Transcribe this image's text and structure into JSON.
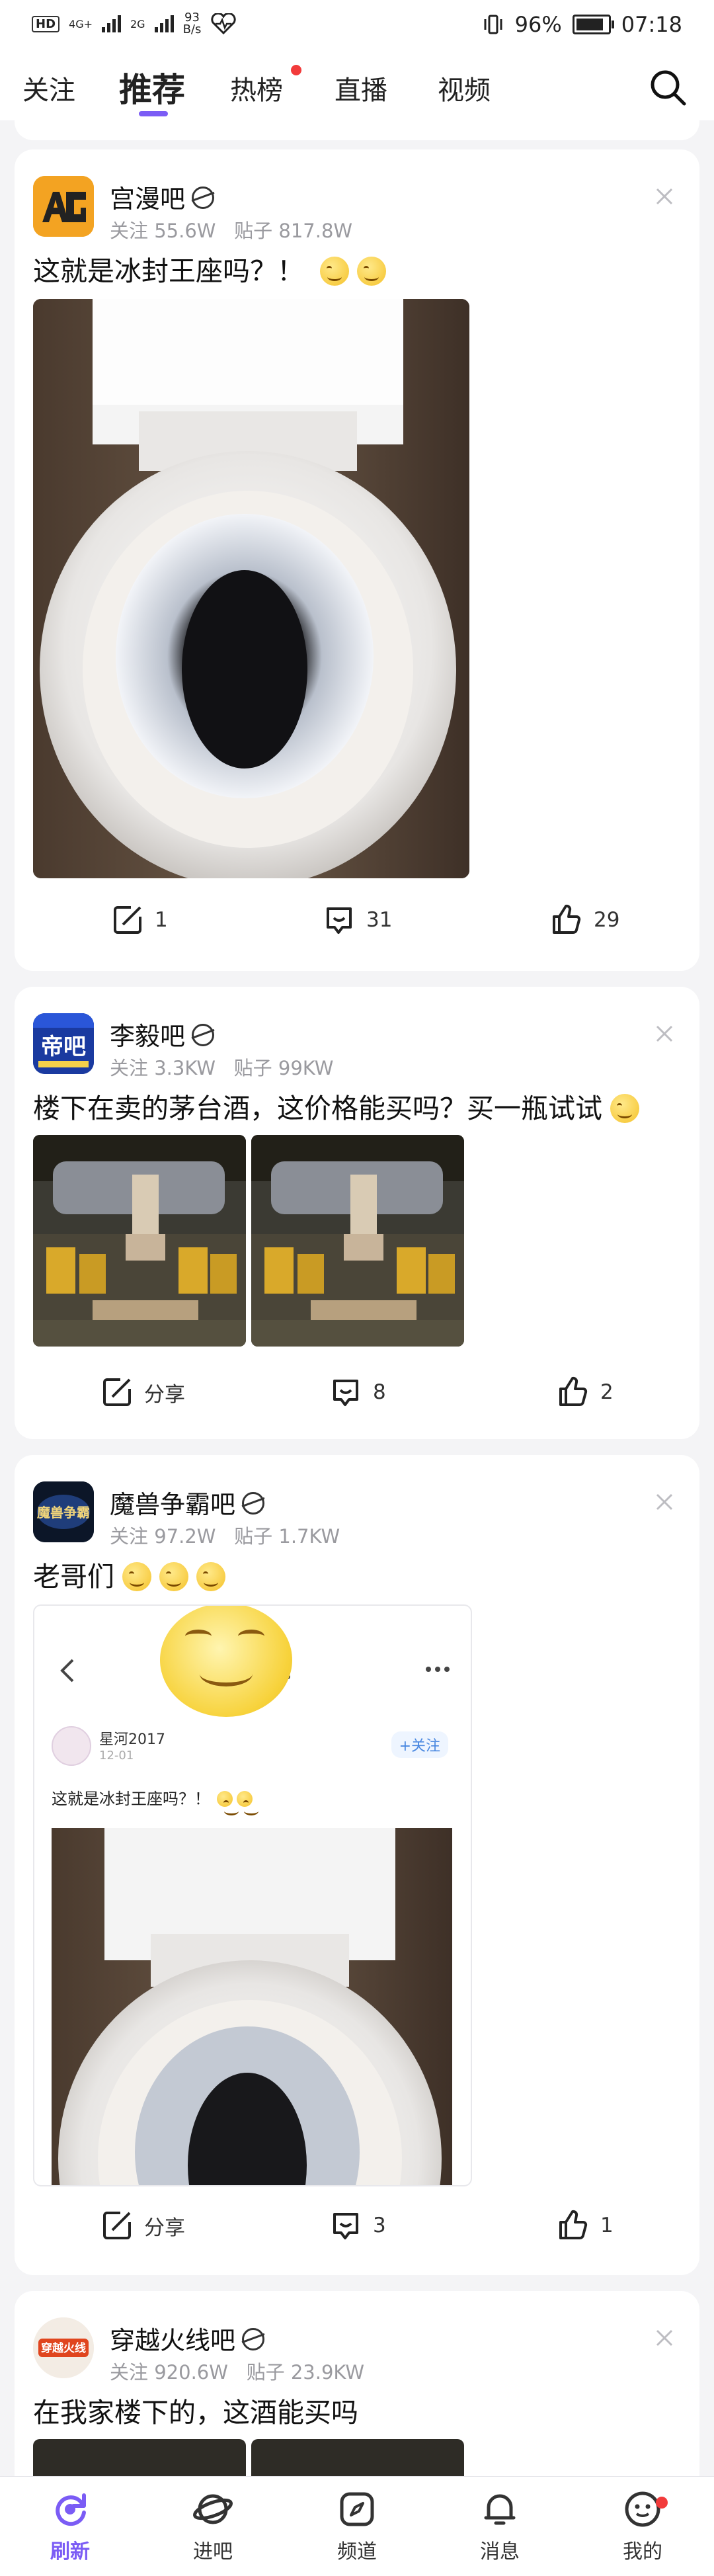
{
  "status_bar": {
    "hd": "HD",
    "net1": "4G+",
    "net2": "2G",
    "speed_value": "93",
    "speed_unit": "B/s",
    "battery": "96%",
    "time": "07:18"
  },
  "top_nav": {
    "tabs": [
      {
        "label": "关注"
      },
      {
        "label": "推荐"
      },
      {
        "label": "热榜"
      },
      {
        "label": "直播"
      },
      {
        "label": "视频"
      }
    ],
    "active_index": 1
  },
  "posts": [
    {
      "forum": "宫漫吧",
      "follow_label": "关注",
      "follow_count": "55.6W",
      "posts_label": "贴子",
      "posts_count": "817.8W",
      "title": "这就是冰封王座吗？！",
      "actions": {
        "share": "1",
        "comments": "31",
        "likes": "29"
      }
    },
    {
      "forum": "李毅吧",
      "follow_label": "关注",
      "follow_count": "3.3KW",
      "posts_label": "贴子",
      "posts_count": "99KW",
      "title": "楼下在卖的茅台酒，这价格能买吗？买一瓶试试",
      "actions": {
        "share": "分享",
        "comments": "8",
        "likes": "2"
      }
    },
    {
      "forum": "魔兽争霸吧",
      "follow_label": "关注",
      "follow_count": "97.2W",
      "posts_label": "贴子",
      "posts_count": "1.7KW",
      "title": "老哥们",
      "embedded": {
        "user": "星河2017",
        "date": "12-01",
        "follow_btn": "+关注",
        "post_title": "这就是冰封王座吗？！",
        "header_suffix": "吧"
      },
      "actions": {
        "share": "分享",
        "comments": "3",
        "likes": "1"
      }
    },
    {
      "forum": "穿越火线吧",
      "follow_label": "关注",
      "follow_count": "920.6W",
      "posts_label": "贴子",
      "posts_count": "23.9KW",
      "title": "在我家楼下的，这酒能买吗"
    }
  ],
  "bottom_nav": {
    "items": [
      {
        "label": "刷新",
        "icon": "refresh-icon"
      },
      {
        "label": "进吧",
        "icon": "planet-icon"
      },
      {
        "label": "频道",
        "icon": "compass-icon"
      },
      {
        "label": "消息",
        "icon": "bell-icon"
      },
      {
        "label": "我的",
        "icon": "face-icon"
      }
    ],
    "active_index": 0
  },
  "colors": {
    "accent": "#7b5cf5",
    "badge": "#f23b3b"
  }
}
